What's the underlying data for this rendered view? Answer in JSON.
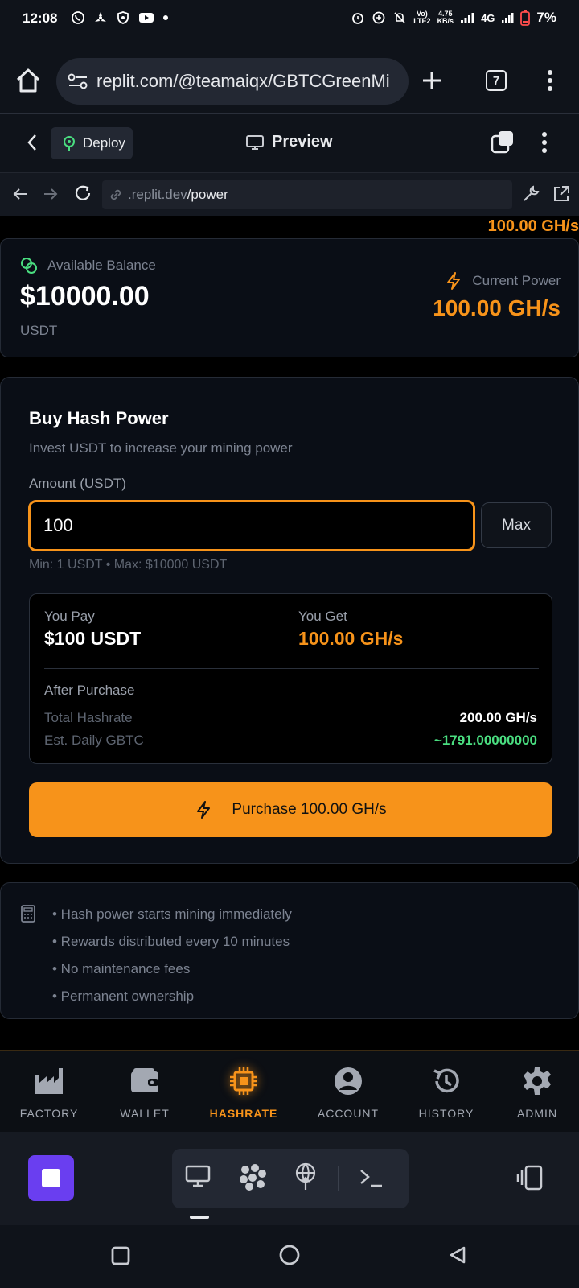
{
  "status_bar": {
    "time": "12:08",
    "speed_top": "4.75",
    "speed_unit": "KB/s",
    "network": "4G",
    "volte": "LTE2",
    "battery": "7%"
  },
  "browser": {
    "url": "replit.com/@teamaiqx/GBTCGreenMi",
    "tab_count": "7"
  },
  "replit_header": {
    "deploy_label": "Deploy",
    "preview_label": "Preview"
  },
  "dev_bar": {
    "host": ".replit.dev",
    "path": "/power"
  },
  "app": {
    "top_power": "100.00 GH/s",
    "balance": {
      "label": "Available Balance",
      "value": "$10000.00",
      "currency": "USDT"
    },
    "current_power": {
      "label": "Current Power",
      "value": "100.00 GH/s"
    },
    "buy": {
      "title": "Buy Hash Power",
      "subtitle": "Invest USDT to increase your mining power",
      "amount_label": "Amount (USDT)",
      "amount_value": "100",
      "max_label": "Max",
      "limits": "Min: 1 USDT • Max: $10000 USDT",
      "summary": {
        "you_pay_label": "You Pay",
        "you_pay_value": "$100 USDT",
        "you_get_label": "You Get",
        "you_get_value": "100.00 GH/s",
        "after_label": "After Purchase",
        "total_hashrate_label": "Total Hashrate",
        "total_hashrate_value": "200.00 GH/s",
        "daily_label": "Est. Daily GBTC",
        "daily_value": "~1791.00000000"
      },
      "purchase_button": "Purchase 100.00 GH/s"
    },
    "info": [
      "• Hash power starts mining immediately",
      "• Rewards distributed every 10 minutes",
      "• No maintenance fees",
      "• Permanent ownership"
    ]
  },
  "bottom_nav": {
    "items": [
      {
        "label": "FACTORY",
        "icon": "factory-icon"
      },
      {
        "label": "WALLET",
        "icon": "wallet-icon"
      },
      {
        "label": "HASHRATE",
        "icon": "chip-icon",
        "active": true
      },
      {
        "label": "ACCOUNT",
        "icon": "user-circle-icon"
      },
      {
        "label": "HISTORY",
        "icon": "history-icon"
      },
      {
        "label": "ADMIN",
        "icon": "gear-icon"
      }
    ]
  },
  "colors": {
    "accent": "#f7931a",
    "positive": "#4ade80",
    "stop_button": "#6a3ef0"
  }
}
